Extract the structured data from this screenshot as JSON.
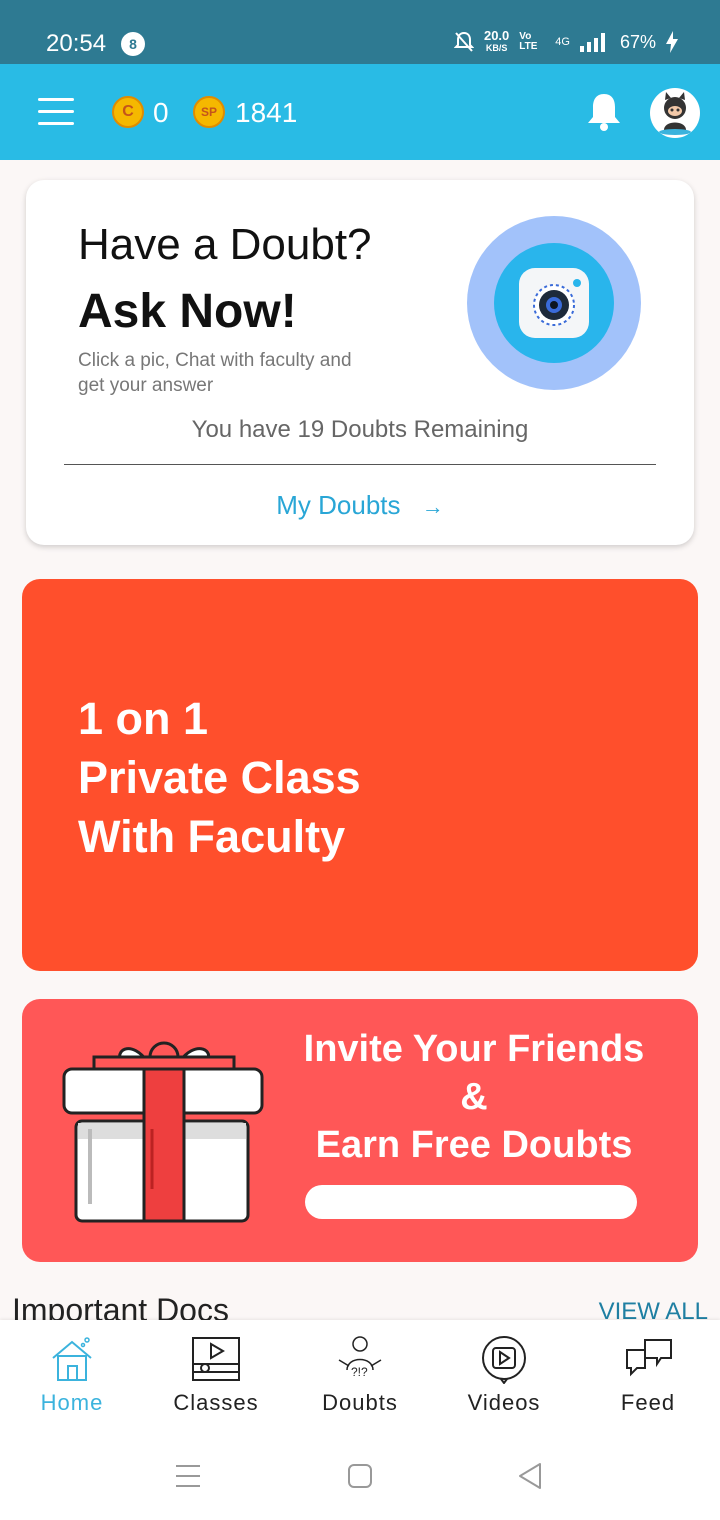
{
  "status_bar": {
    "time": "20:54",
    "notification_count": "8",
    "net_speed_value": "20.0",
    "net_speed_unit": "KB/S",
    "volte": "Vo LTE",
    "network": "4G",
    "battery": "67%"
  },
  "app_bar": {
    "coin_c_symbol": "C",
    "coin_c_value": "0",
    "coin_sp_symbol": "SP",
    "coin_sp_value": "1841"
  },
  "doubt_card": {
    "title_line1": "Have a Doubt?",
    "title_line2": "Ask Now!",
    "subtitle": "Click a pic, Chat with faculty and get your answer",
    "remaining": "You have 19 Doubts Remaining",
    "my_doubts_label": "My Doubts",
    "arrow": "→"
  },
  "private_class_card": {
    "line1": "1 on 1",
    "line2": "Private Class",
    "line3": "With Faculty"
  },
  "invite_card": {
    "line1": "Invite Your Friends",
    "line2": "&",
    "line3": "Earn Free Doubts"
  },
  "important_docs": {
    "title": "Important Docs",
    "view_all": "VIEW ALL"
  },
  "bottom_nav": {
    "items": [
      {
        "label": "Home",
        "active": true
      },
      {
        "label": "Classes",
        "active": false
      },
      {
        "label": "Doubts",
        "active": false
      },
      {
        "label": "Videos",
        "active": false
      },
      {
        "label": "Feed",
        "active": false
      }
    ]
  },
  "colors": {
    "status_bar": "#2e7a92",
    "app_bar": "#29bbe5",
    "private_card": "#ff4f2c",
    "invite_card": "#ff5757",
    "active_nav": "#3bb3dd"
  }
}
